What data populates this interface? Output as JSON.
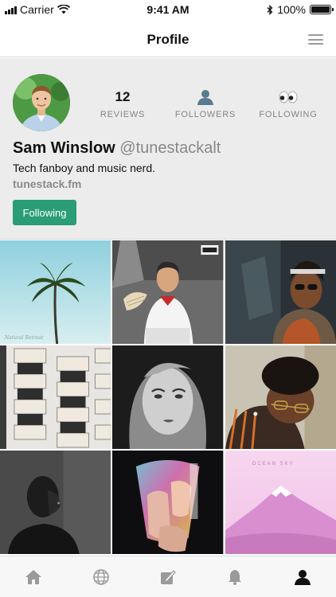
{
  "status_bar": {
    "carrier": "Carrier",
    "time": "9:41 AM",
    "battery": "100%",
    "battery_level": 1.0
  },
  "nav": {
    "title": "Profile",
    "menu_icon": "hamburger-menu-icon"
  },
  "profile": {
    "name": "Sam Winslow",
    "handle": "@tunestackalt",
    "bio": "Tech fanboy and music nerd.",
    "website": "tunestack.fm",
    "follow_button": "Following",
    "stats": [
      {
        "value": "12",
        "label": "REVIEWS"
      },
      {
        "icon": "person-icon",
        "label": "FOLLOWERS"
      },
      {
        "icon": "eyes-emoji",
        "value": "👀",
        "label": "FOLLOWING"
      }
    ]
  },
  "album_art_text": {
    "tile_1": "Natural Retreat",
    "tile_9": "OCEAN SKY"
  },
  "tabs": [
    {
      "name": "home",
      "icon": "home-icon",
      "active": false
    },
    {
      "name": "explore",
      "icon": "globe-icon",
      "active": false
    },
    {
      "name": "compose",
      "icon": "compose-icon",
      "active": false
    },
    {
      "name": "notifications",
      "icon": "bell-icon",
      "active": false
    },
    {
      "name": "profile",
      "icon": "person-icon",
      "active": true
    }
  ],
  "colors": {
    "accent": "#2a9d77",
    "header_bg": "#ececec",
    "tab_inactive": "#9a9a9a",
    "tab_active": "#111111"
  }
}
